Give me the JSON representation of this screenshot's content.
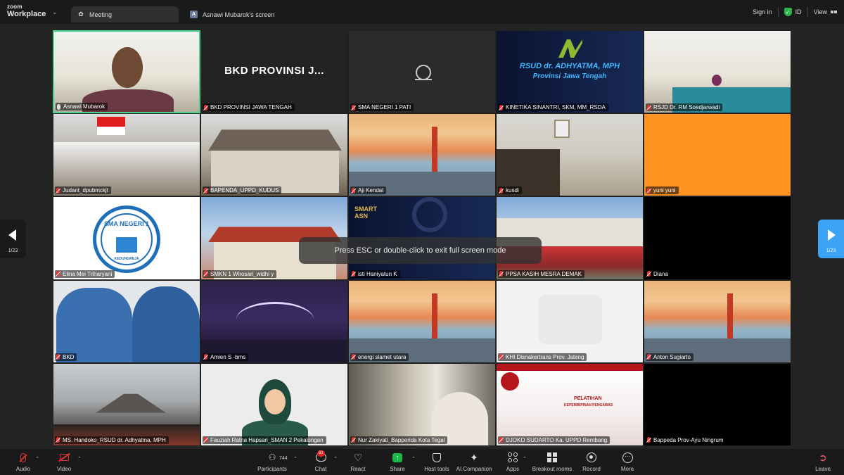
{
  "app": {
    "logo_line1": "zoom",
    "logo_line2": "Workplace"
  },
  "tabs": [
    {
      "label": "Meeting",
      "active": true
    },
    {
      "label": "Asnawi Mubarok's screen",
      "active": false,
      "avatar": "A"
    }
  ],
  "topbar": {
    "sign_in": "Sign in",
    "id_label": "ID",
    "view_label": "View"
  },
  "participants": [
    {
      "name": "Asnawi Mubarok",
      "muted": false,
      "speaking": true
    },
    {
      "name": "BKD PROVINSI JAWA TENGAH",
      "muted": true,
      "tile_text": "BKD PROVINSI J..."
    },
    {
      "name": "SMA NEGERI 1 PATI",
      "muted": true
    },
    {
      "name": "KINETIKA SINANTRI, SKM, MM_RSDA",
      "muted": true,
      "tile_text_1": "RSUD dr. ADHYATMA, MPH",
      "tile_text_2": "Provinsi Jawa Tengah"
    },
    {
      "name": "RSJD Dr. RM Soedjarwadi",
      "muted": true
    },
    {
      "name": "Judant_dpubmckjt",
      "muted": true
    },
    {
      "name": "BAPENDA_UPPD_KUDUS",
      "muted": true
    },
    {
      "name": "Aji Kendal",
      "muted": true
    },
    {
      "name": "kusdi",
      "muted": true
    },
    {
      "name": "yuni yuni",
      "muted": true
    },
    {
      "name": "Elina Mei Triharyani",
      "muted": true,
      "tile_text_1": "SMA NEGERI 1",
      "tile_text_2": "KEDUNGREJA"
    },
    {
      "name": "SMKN 1 Wirosari_widhi y",
      "muted": true
    },
    {
      "name": "isti Haniyatun K",
      "muted": true,
      "tile_text_1": "SMART",
      "tile_text_2": "ASN"
    },
    {
      "name": "PPSA KASIH MESRA DEMAK",
      "muted": true
    },
    {
      "name": "Diana",
      "muted": true
    },
    {
      "name": "BKD",
      "muted": true
    },
    {
      "name": "Amien S -bms",
      "muted": true
    },
    {
      "name": "energi slamet utara",
      "muted": true
    },
    {
      "name": "KHI Disnakertrans Prov. Jateng",
      "muted": true
    },
    {
      "name": "Anton Sugiarto",
      "muted": true
    },
    {
      "name": "MS. Handoko_RSUD dr. Adhyatma, MPH",
      "muted": true
    },
    {
      "name": "Fauziah Ratna Hapsari_SMAN 2 Pekalongan",
      "muted": true
    },
    {
      "name": "Nur Zakiyati_Bapperida Kota Tegal",
      "muted": true
    },
    {
      "name": "DJOKO SUDARTO Ka. UPPD Rembang",
      "muted": true,
      "tile_text_1": "PELATIHAN",
      "tile_text_2": "KEPEMIMPINAN PENGAWAS"
    },
    {
      "name": "Bappeda Prov-Ayu Ningrum",
      "muted": true
    }
  ],
  "toast": "Press ESC or double-click to exit full screen mode",
  "pagination": {
    "left": "1/23",
    "right": "1/23"
  },
  "toolbar": {
    "audio": "Audio",
    "video": "Video",
    "participants": "Participants",
    "participants_count": "744",
    "chat": "Chat",
    "chat_badge": "61",
    "react": "React",
    "share": "Share",
    "host_tools": "Host tools",
    "ai_companion": "AI Companion",
    "apps": "Apps",
    "breakout_rooms": "Breakout rooms",
    "record": "Record",
    "more": "More",
    "leave": "Leave"
  },
  "colors": {
    "speaking_border": "#4fd18b",
    "share_green": "#19b74a",
    "nav_blue": "#3da3f4",
    "muted_red": "#e03232"
  }
}
